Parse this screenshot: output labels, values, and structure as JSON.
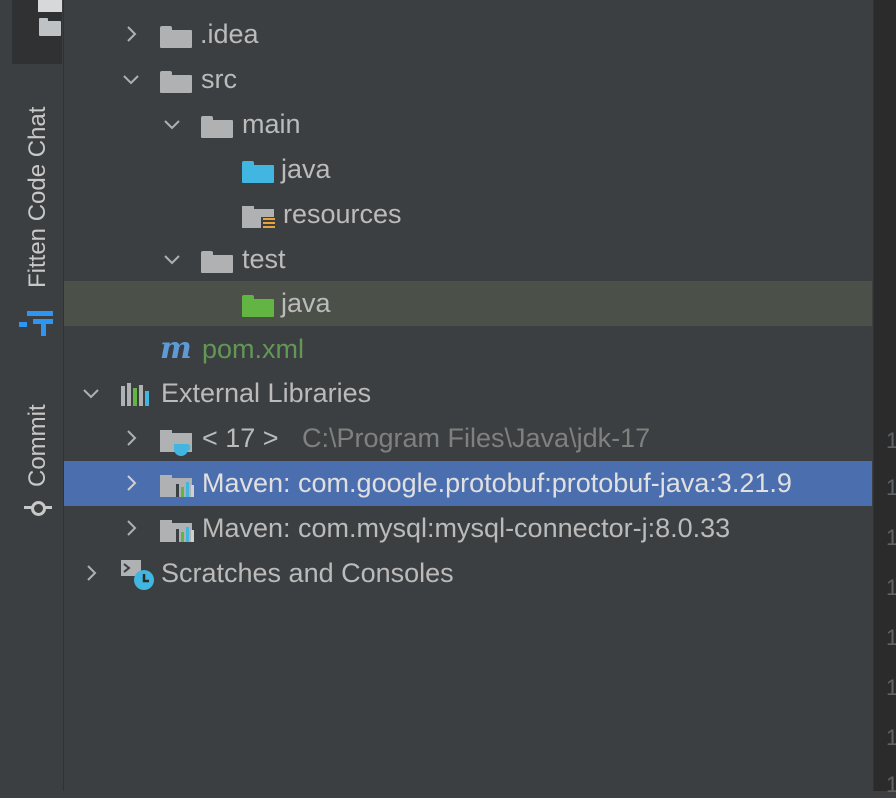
{
  "toolwindows": {
    "fitten_label": "Fitten Code Chat",
    "commit_label": "Commit"
  },
  "tree": {
    "items": [
      {
        "label": ".idea",
        "expanded": false,
        "icon": "folder-icon"
      },
      {
        "label": "src",
        "expanded": true,
        "icon": "folder-icon"
      },
      {
        "label": "main",
        "expanded": true,
        "icon": "folder-icon"
      },
      {
        "label": "java",
        "icon": "source-root-folder-icon"
      },
      {
        "label": "resources",
        "icon": "resources-folder-icon"
      },
      {
        "label": "test",
        "expanded": true,
        "icon": "folder-icon"
      },
      {
        "label": "java",
        "icon": "test-root-folder-icon",
        "selected": true
      },
      {
        "label": "pom.xml",
        "icon": "maven-icon"
      },
      {
        "label": "External Libraries",
        "expanded": true,
        "icon": "libraries-icon"
      },
      {
        "label": "< 17 >",
        "detail": "C:\\Program Files\\Java\\jdk-17",
        "expanded": false,
        "icon": "jdk-icon"
      },
      {
        "label": "Maven: com.google.protobuf:protobuf-java:3.21.9",
        "expanded": false,
        "icon": "library-icon",
        "highlighted": true
      },
      {
        "label": "Maven: com.mysql:mysql-connector-j:8.0.33",
        "expanded": false,
        "icon": "library-icon"
      },
      {
        "label": "Scratches and Consoles",
        "expanded": false,
        "icon": "scratches-icon"
      }
    ]
  },
  "gutter": {
    "numbers": [
      "1",
      "1",
      "1",
      "1",
      "1",
      "1",
      "1",
      "1"
    ]
  },
  "colors": {
    "background": "#3c3f41",
    "selection_inactive": "#4b5049",
    "selection_active": "#4b6eaf",
    "text": "#bbbbbb",
    "muted": "#808080",
    "test_green": "#629755",
    "accent_blue": "#2f95f0"
  }
}
